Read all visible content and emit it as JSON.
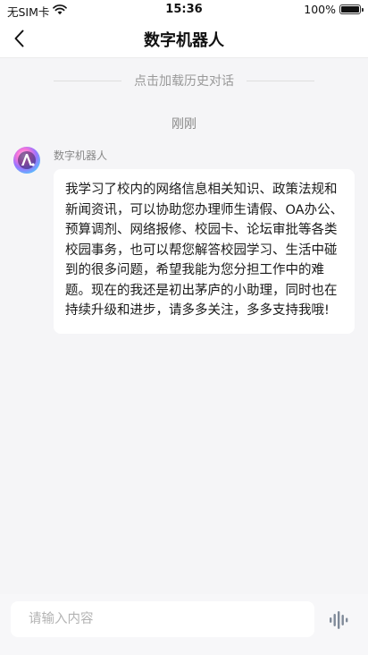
{
  "status_bar": {
    "carrier": "无SIM卡",
    "time": "15:36",
    "battery_percent": "100%",
    "battery_level": 1.0
  },
  "nav": {
    "title": "数字机器人"
  },
  "chat": {
    "load_history": "点击加载历史对话",
    "timestamp": "刚刚",
    "messages": [
      {
        "sender": "数字机器人",
        "text": "我学习了校内的网络信息相关知识、政策法规和新闻资讯，可以协助您办理师生请假、OA办公、预算调剂、网络报修、校园卡、论坛审批等各类校园事务，也可以帮您解答校园学习、生活中碰到的很多问题，希望我能为您分担工作中的难题。现在的我还是初出茅庐的小助理，同时也在持续升级和进步，请多多关注，多多支持我哦!"
      }
    ]
  },
  "input": {
    "placeholder": "请输入内容",
    "value": ""
  },
  "icons": {
    "back": "chevron-left-icon",
    "wifi": "wifi-icon",
    "battery": "battery-icon",
    "avatar": "robot-logo-icon",
    "voice": "voice-wave-icon"
  },
  "colors": {
    "background": "#f5f5f7",
    "bubble": "#ffffff",
    "muted_text": "#999999",
    "avatar_gradient": [
      "#ff5fd2",
      "#8a5cff",
      "#3ab8ff"
    ]
  }
}
